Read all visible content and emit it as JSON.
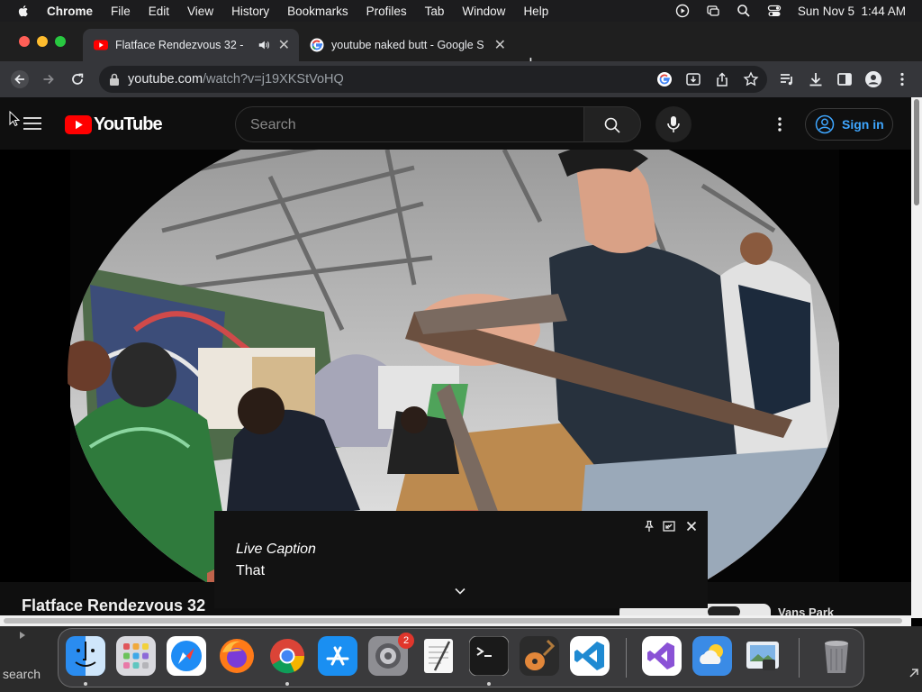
{
  "menubar": {
    "app": "Chrome",
    "items": [
      "File",
      "Edit",
      "View",
      "History",
      "Bookmarks",
      "Profiles",
      "Tab",
      "Window",
      "Help"
    ],
    "clock": "Sun Nov 5  1:44 AM"
  },
  "tabs": [
    {
      "title": "Flatface Rendezvous 32 -",
      "active": true
    },
    {
      "title": "youtube naked butt - Google S",
      "active": false
    }
  ],
  "omnibox": {
    "host": "youtube.com",
    "path": "/watch?v=j19XKStVoHQ"
  },
  "youtube": {
    "logo": "YouTube",
    "search_placeholder": "Search",
    "sign_in": "Sign in",
    "video_title": "Flatface Rendezvous 32",
    "suggestion_title": "Vans Park"
  },
  "live_caption": {
    "title": "Live Caption",
    "text": "That"
  },
  "background": {
    "search_label": "search"
  },
  "dock": {
    "apps": [
      "Finder",
      "Launchpad",
      "Safari",
      "Firefox",
      "Google Chrome",
      "App Store",
      "System Settings",
      "TextEdit",
      "Terminal",
      "GarageBand",
      "Visual Studio Code",
      "Visual Studio",
      "Weather",
      "Preview",
      "Trash"
    ],
    "settings_badge": "2"
  },
  "colors": {
    "youtube_red": "#ff0000",
    "link_blue": "#3ea6ff",
    "chrome_dark": "#35363a"
  }
}
